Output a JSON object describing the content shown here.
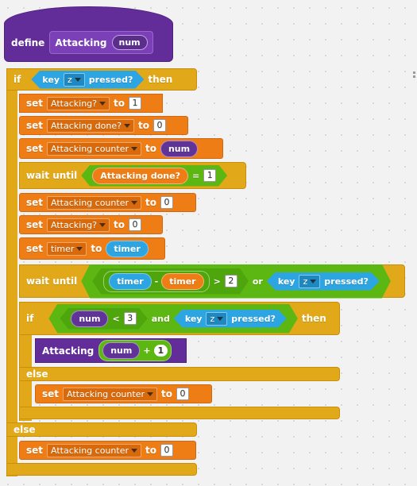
{
  "define": {
    "keyword": "define",
    "name": "Attacking",
    "param": "num"
  },
  "if1": {
    "kw_if": "if",
    "key": "key",
    "key_val": "z",
    "pressed": "pressed?",
    "then": "then"
  },
  "set_lbl": "set",
  "to_lbl": "to",
  "s1": {
    "var": "Attacking?",
    "val": "1"
  },
  "s2": {
    "var": "Attacking done?",
    "val": "0"
  },
  "s3": {
    "var": "Attacking counter",
    "val": "num"
  },
  "wait1": {
    "label": "wait until",
    "var": "Attacking done?",
    "op": "=",
    "val": "1"
  },
  "s4": {
    "var": "Attacking counter",
    "val": "0"
  },
  "s5": {
    "var": "Attacking?",
    "val": "0"
  },
  "s6": {
    "var": "timer",
    "val": "timer"
  },
  "wait2": {
    "label": "wait until",
    "a": "timer",
    "minus": "-",
    "b": "timer",
    "gt": ">",
    "val": "2",
    "or": "or",
    "key": "key",
    "key_val": "z",
    "pressed": "pressed?"
  },
  "if2": {
    "kw_if": "if",
    "num": "num",
    "lt": "<",
    "val": "3",
    "and": "and",
    "key": "key",
    "key_val": "z",
    "pressed": "pressed?",
    "then": "then"
  },
  "call": {
    "name": "Attacking",
    "arg": "num",
    "plus": "+",
    "val": "1"
  },
  "else1": "else",
  "s7": {
    "var": "Attacking counter",
    "val": "0"
  },
  "else2": "else",
  "s8": {
    "var": "Attacking counter",
    "val": "0"
  },
  "colors": {
    "control": "#e1a91a",
    "data": "#ee7d16",
    "sensing": "#2ca5e2",
    "operators": "#5cb712",
    "more_blocks": "#632d99"
  }
}
